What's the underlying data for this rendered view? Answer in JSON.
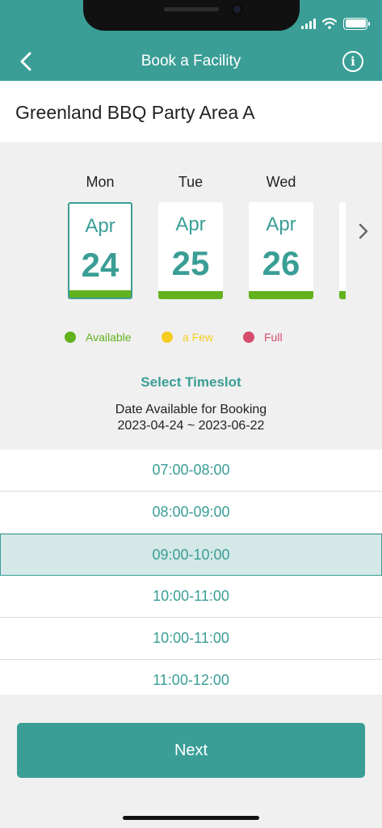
{
  "header": {
    "title": "Book a Facility"
  },
  "facility": {
    "name": "Greenland BBQ Party Area A"
  },
  "dates": [
    {
      "weekday": "Mon",
      "month": "Apr",
      "day": "24",
      "selected": true,
      "status": "Available"
    },
    {
      "weekday": "Tue",
      "month": "Apr",
      "day": "25",
      "selected": false,
      "status": "Available"
    },
    {
      "weekday": "Wed",
      "month": "Apr",
      "day": "26",
      "selected": false,
      "status": "Available"
    }
  ],
  "legend": [
    {
      "label": "Available",
      "color": "#62b21d"
    },
    {
      "label": "a Few",
      "color": "#f6cc1f"
    },
    {
      "label": "Full",
      "color": "#d64d6b"
    }
  ],
  "timeslot_section": {
    "title": "Select Timeslot",
    "range_label": "Date Available for Booking",
    "range_value": "2023-04-24 ~ 2023-06-22"
  },
  "timeslots": [
    {
      "label": "07:00-08:00",
      "selected": false
    },
    {
      "label": "08:00-09:00",
      "selected": false
    },
    {
      "label": "09:00-10:00",
      "selected": true
    },
    {
      "label": "10:00-11:00",
      "selected": false
    },
    {
      "label": "10:00-11:00",
      "selected": false
    },
    {
      "label": "11:00-12:00",
      "selected": false
    }
  ],
  "actions": {
    "next_label": "Next"
  },
  "colors": {
    "primary": "#3a9e96",
    "available": "#62b21d",
    "few": "#f6cc1f",
    "full": "#d64d6b"
  },
  "icons": {
    "back": "chevron-left-icon",
    "info": "info-icon",
    "next_dates": "chevron-right-icon",
    "signal": "signal-icon",
    "wifi": "wifi-icon",
    "battery": "battery-icon"
  }
}
